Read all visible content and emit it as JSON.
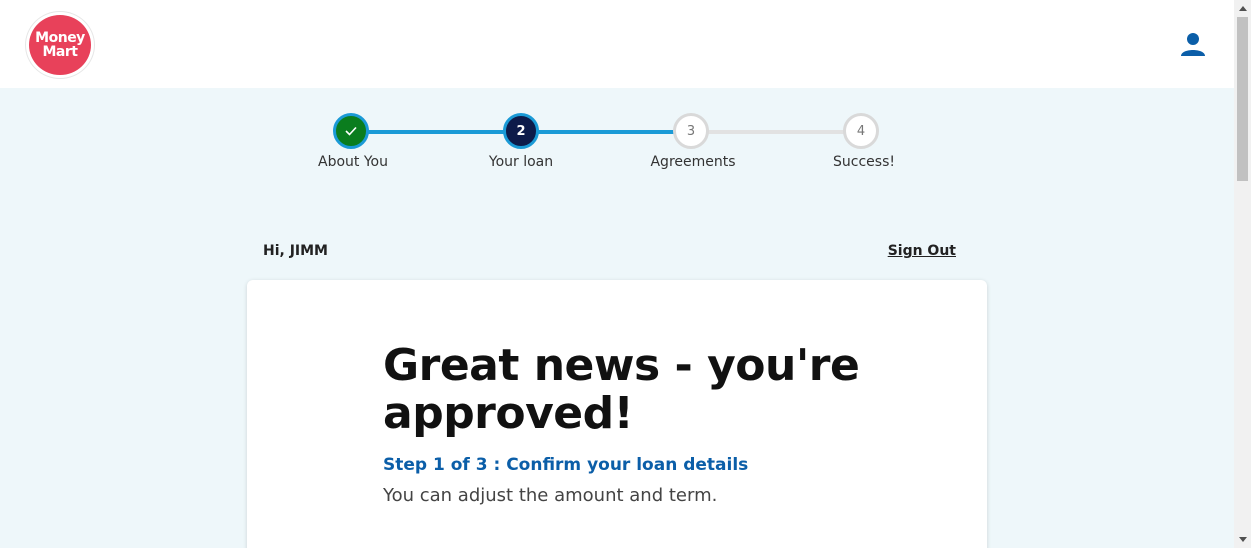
{
  "header": {
    "logo_line1": "Money",
    "logo_line2": "Mart",
    "brand_color": "#e8415a",
    "account_icon": "user-icon"
  },
  "stepper": {
    "steps": [
      {
        "number": "",
        "label": "About You",
        "state": "completed",
        "icon": "check-icon"
      },
      {
        "number": "2",
        "label": "Your loan",
        "state": "current"
      },
      {
        "number": "3",
        "label": "Agreements",
        "state": "upcoming"
      },
      {
        "number": "4",
        "label": "Success!",
        "state": "upcoming"
      }
    ],
    "colors": {
      "completed": "#0a7d1e",
      "current": "#0d1b4a",
      "active_ring": "#1a9ad6",
      "inactive": "#d9d9d9"
    }
  },
  "greeting": {
    "hi": "Hi, JIMM",
    "sign_out": "Sign Out"
  },
  "card": {
    "headline": "Great news - you're approved!",
    "step_note": "Step 1 of 3 : Confirm your loan details",
    "subtext": "You can adjust the amount and term."
  }
}
